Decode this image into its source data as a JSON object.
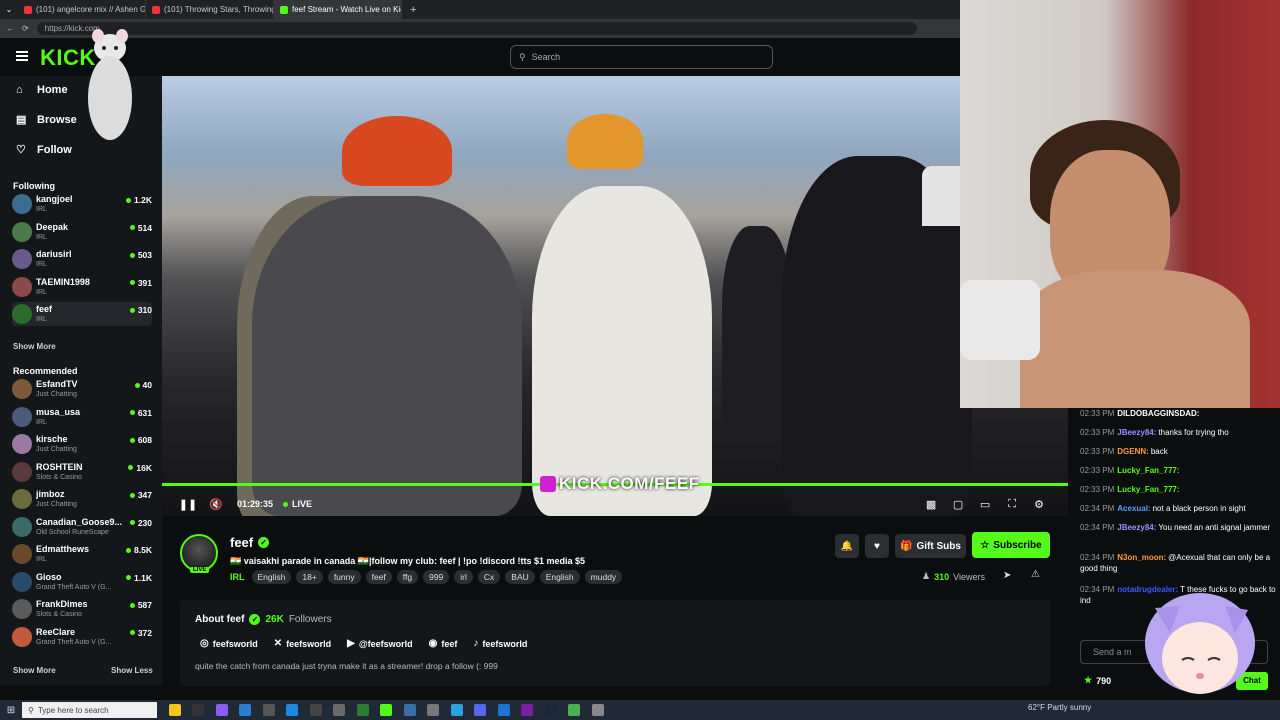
{
  "browser": {
    "tabs": [
      {
        "label": "(101) angelcore mix // Ashen Glo"
      },
      {
        "label": "(101) Throwing Stars, Throwing In"
      },
      {
        "label": "feef Stream - Watch Live on Kick"
      }
    ],
    "url": "https://kick.com"
  },
  "header": {
    "logo": "KICK",
    "search_placeholder": "Search"
  },
  "nav": {
    "home": "Home",
    "browse": "Browse",
    "following": "Follow"
  },
  "sidebar": {
    "following_title": "Following",
    "following": [
      {
        "name": "kangjoel",
        "category": "IRL",
        "viewers": "1.2K",
        "color": "#3a6d8f"
      },
      {
        "name": "Deepak",
        "category": "IRL",
        "viewers": "514",
        "color": "#4a7a4a"
      },
      {
        "name": "dariusirl",
        "category": "IRL",
        "viewers": "503",
        "color": "#6a5a8a"
      },
      {
        "name": "TAEMIN1998",
        "category": "IRL",
        "viewers": "391",
        "color": "#8a4a4a"
      },
      {
        "name": "feef",
        "category": "IRL",
        "viewers": "310",
        "color": "#2d6a2d"
      }
    ],
    "show_more_1": "Show More",
    "recommended_title": "Recommended",
    "recommended": [
      {
        "name": "EsfandTV",
        "category": "Just Chatting",
        "viewers": "40",
        "color": "#7a5a3a"
      },
      {
        "name": "musa_usa",
        "category": "IRL",
        "viewers": "631",
        "color": "#4a5a7a"
      },
      {
        "name": "kirsche",
        "category": "Just Chatting",
        "viewers": "608",
        "color": "#9a7aa0"
      },
      {
        "name": "ROSHTEIN",
        "category": "Slots & Casino",
        "viewers": "16K",
        "color": "#5a3a3a"
      },
      {
        "name": "jimboz",
        "category": "Just Chatting",
        "viewers": "347",
        "color": "#6a6a3a"
      },
      {
        "name": "Canadian_Goose9...",
        "category": "Old School RuneScape",
        "viewers": "230",
        "color": "#3a6a6a"
      },
      {
        "name": "Edmatthews",
        "category": "IRL",
        "viewers": "8.5K",
        "color": "#6a4a2a"
      },
      {
        "name": "Gioso",
        "category": "Grand Theft Auto V (G...",
        "viewers": "1.1K",
        "color": "#2a4a6a"
      },
      {
        "name": "FrankDimes",
        "category": "Slots & Casino",
        "viewers": "587",
        "color": "#5a5a5a"
      },
      {
        "name": "ReeClare",
        "category": "Grand Theft Auto V (G...",
        "viewers": "372",
        "color": "#c05a3a"
      }
    ],
    "show_more_2": "Show More",
    "show_less": "Show Less"
  },
  "player": {
    "overlay_text": "KICK.COM/FEEF",
    "time": "01:29:35",
    "live": "LIVE",
    "progress": 1.0
  },
  "stream": {
    "streamer": "feef",
    "live_badge": "LIVE",
    "title": "🇮🇳 vaisakhi parade in canada 🇮🇳|follow my club: feef | !po !discord !tts $1 media $5",
    "category": "IRL",
    "tags": [
      "English",
      "18+",
      "funny",
      "feef",
      "ffg",
      "999",
      "irl",
      "Cx",
      "BAU",
      "English",
      "muddy"
    ],
    "gift_label": "Gift Subs",
    "subscribe_label": "Subscribe",
    "viewers_count": "310",
    "viewers_label": "Viewers"
  },
  "about": {
    "title": "About feef",
    "followers_count": "26K",
    "followers_label": "Followers",
    "socials": [
      {
        "icon": "instagram-icon",
        "glyph": "◎",
        "label": "feefsworld"
      },
      {
        "icon": "x-icon",
        "glyph": "✕",
        "label": "feefsworld"
      },
      {
        "icon": "youtube-icon",
        "glyph": "▶",
        "label": "@feefsworld"
      },
      {
        "icon": "discord-icon",
        "glyph": "◉",
        "label": "feef"
      },
      {
        "icon": "tiktok-icon",
        "glyph": "♪",
        "label": "feefsworld"
      }
    ],
    "bio": "quite the catch from canada just tryna make it as a streamer! drop a follow (: 999"
  },
  "chat": {
    "messages": [
      {
        "time": "02:33 PM",
        "user": "DILDOBAGGINSDAD:",
        "text": "",
        "color": "#ffffff"
      },
      {
        "time": "02:33 PM",
        "user": "JBeezy84:",
        "text": "thanks for trying tho",
        "color": "#9a8cff"
      },
      {
        "time": "02:33 PM",
        "user": "DGENN:",
        "text": "back",
        "color": "#ff9a3a"
      },
      {
        "time": "02:33 PM",
        "user": "Lucky_Fan_777:",
        "text": "",
        "color": "#53fc18"
      },
      {
        "time": "02:33 PM",
        "user": "Lucky_Fan_777:",
        "text": "",
        "color": "#53fc18"
      },
      {
        "time": "02:34 PM",
        "user": "Acexual:",
        "text": "not a black person in sight",
        "color": "#5aa0ff"
      },
      {
        "time": "02:34 PM",
        "user": "JBeezy84:",
        "text": "You need an anti signal jammer",
        "color": "#9a8cff"
      },
      {
        "time": "02:34 PM",
        "user": "N3on_moon:",
        "text": "@Acexual that can only be a good thing",
        "color": "#ff9a3a"
      },
      {
        "time": "02:34 PM",
        "user": "notadrugdealer:",
        "text": "T    these fucks to go back to ind",
        "color": "#3a5aff"
      }
    ],
    "input_placeholder": "Send a m",
    "points": "790",
    "send_label": "Chat"
  },
  "taskbar": {
    "search_placeholder": "Type here to search",
    "weather": "62°F  Partly sunny"
  }
}
